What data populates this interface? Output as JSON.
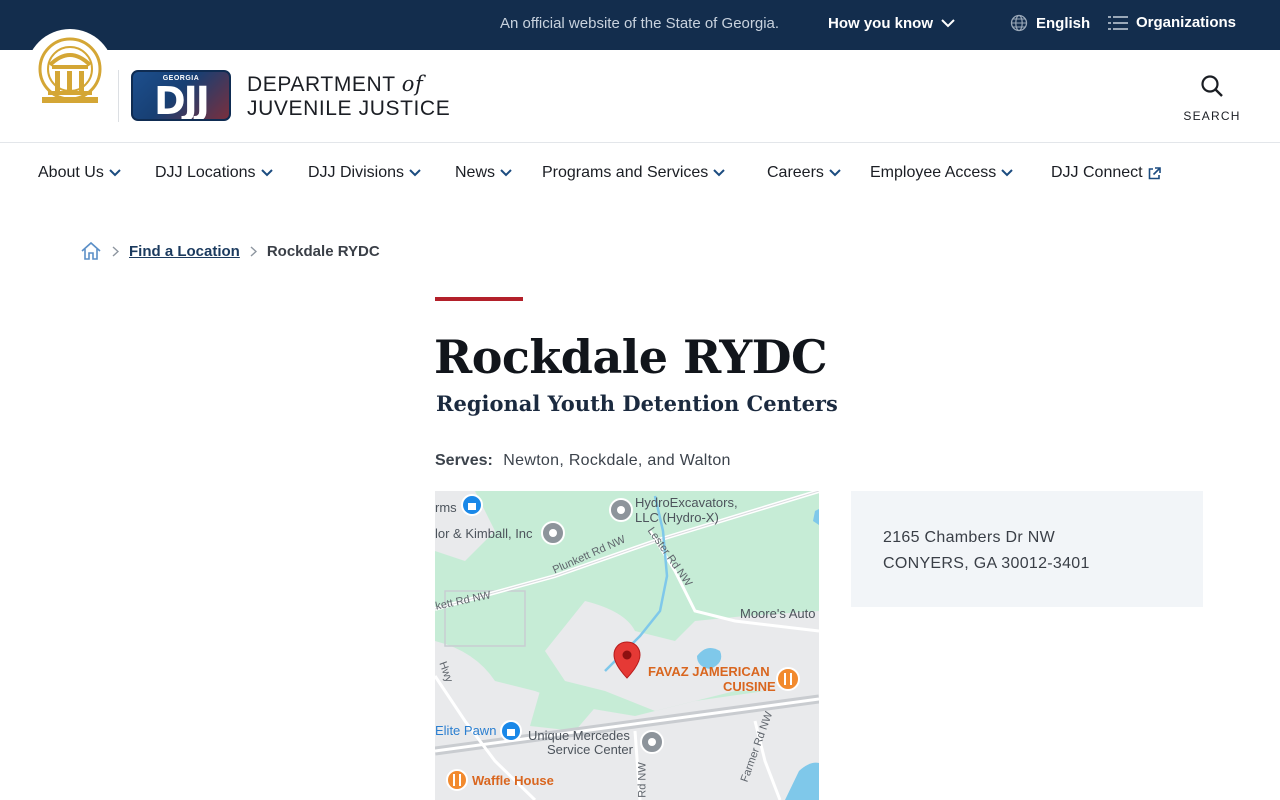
{
  "gov_bar": {
    "official_text": "An official website of the State of Georgia.",
    "how_you_know": "How you know",
    "language": "English",
    "organizations": "Organizations"
  },
  "header": {
    "logo_state": "GEORGIA",
    "logo_text": "DJJ",
    "dept_line1": "DEPARTMENT",
    "dept_of": "of",
    "dept_line2": "JUVENILE JUSTICE",
    "search_label": "SEARCH"
  },
  "nav": {
    "items": [
      {
        "label": "About Us"
      },
      {
        "label": "DJJ Locations"
      },
      {
        "label": "DJJ Divisions"
      },
      {
        "label": "News"
      },
      {
        "label": "Programs and Services"
      },
      {
        "label": "Careers"
      },
      {
        "label": "Employee Access"
      },
      {
        "label": "DJJ Connect"
      }
    ]
  },
  "breadcrumb": {
    "link": "Find a Location",
    "current": "Rockdale RYDC"
  },
  "main": {
    "title": "Rockdale RYDC",
    "subtitle": "Regional Youth Detention Centers",
    "serves_label": "Serves:",
    "serves_value": "Newton, Rockdale, and Walton"
  },
  "map": {
    "labels": {
      "farms": "rms",
      "hydro1": "HydroExcavators,",
      "hydro2": "LLC (Hydro-X)",
      "taylor": "lor & Kimball, Inc",
      "plunkett": "Plunkett Rd NW",
      "lester": "Lester Rd NW",
      "kett": "kett Rd NW",
      "moores": "Moore's Auto",
      "favaz1": "FAVAZ JAMERICAN",
      "favaz2": "CUISINE",
      "hwy": "Hwy",
      "elite": "Elite Pawn",
      "unique1": "Unique Mercedes",
      "unique2": "Service Center",
      "rdnw": "Rd NW",
      "farmer": "Farmer Rd NW",
      "waffle": "Waffle House"
    }
  },
  "address": {
    "line1": "2165 Chambers Dr NW",
    "line2": "CONYERS, GA 30012-3401"
  },
  "colors": {
    "gov_bar": "#132d4d",
    "accent": "#b3202a",
    "address_bg": "#f2f5f8",
    "map_green": "#c6ecd6",
    "pin_red": "#e53935"
  }
}
